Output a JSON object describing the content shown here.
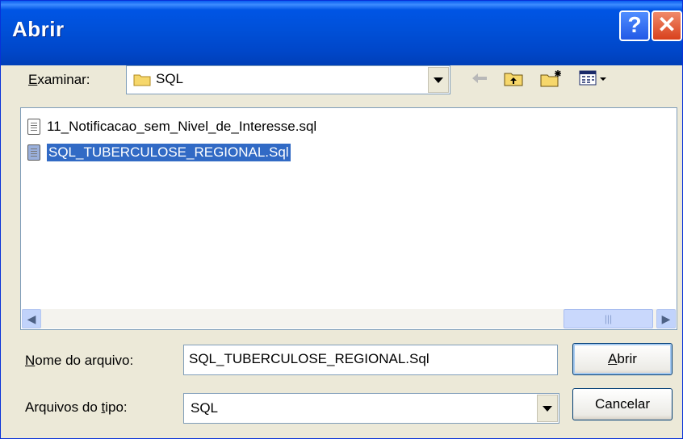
{
  "dialog": {
    "title": "Abrir"
  },
  "titlebar": {
    "help_glyph": "?",
    "close_glyph": "✕"
  },
  "lookin": {
    "label_first": "E",
    "label_rest": "xaminar:",
    "value": "SQL",
    "icon": "folder-icon"
  },
  "toolbar": {
    "back_icon": "back-arrow-icon",
    "up_icon": "up-folder-icon",
    "new_icon": "new-folder-icon",
    "view_icon": "view-menu-icon"
  },
  "files": [
    {
      "name": "11_Notificacao_sem_Nivel_de_Interesse.sql",
      "selected": false
    },
    {
      "name": "SQL_TUBERCULOSE_REGIONAL.Sql",
      "selected": true
    }
  ],
  "filename": {
    "label_first": "N",
    "label_rest": "ome do arquivo:",
    "value": "SQL_TUBERCULOSE_REGIONAL.Sql"
  },
  "filetype": {
    "label_pre": "Arquivos do ",
    "label_u": "t",
    "label_post": "ipo:",
    "value": "SQL"
  },
  "buttons": {
    "open_first": "A",
    "open_rest": "brir",
    "cancel": "Cancelar"
  },
  "colors": {
    "titlebar": "#0055e5",
    "selection": "#316ac5",
    "face": "#ece9d8"
  }
}
